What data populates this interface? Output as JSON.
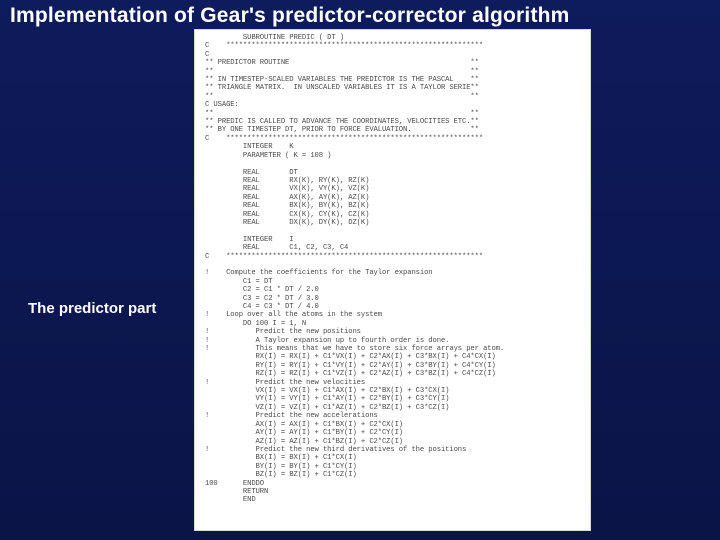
{
  "title": "Implementation of Gear's predictor-corrector algorithm",
  "caption": "The predictor part",
  "code": "         SUBROUTINE PREDIC ( DT )\nC    *************************************************************\nC\n** PREDICTOR ROUTINE                                           **\n**                                                             **\n** IN TIMESTEP-SCALED VARIABLES THE PREDICTOR IS THE PASCAL    **\n** TRIANGLE MATRIX.  IN UNSCALED VARIABLES IT IS A TAYLOR SERIE**\n**                                                             **\nC USAGE:                                                          \n**                                                             **\n** PREDIC IS CALLED TO ADVANCE THE COORDINATES, VELOCITIES ETC.**\n** BY ONE TIMESTEP DT, PRIOR TO FORCE EVALUATION.              **\nC    *************************************************************\n         INTEGER    K\n         PARAMETER ( K = 108 )\n\n         REAL       DT\n         REAL       RX(K), RY(K), RZ(K)\n         REAL       VX(K), VY(K), VZ(K)\n         REAL       AX(K), AY(K), AZ(K)\n         REAL       BX(K), BY(K), BZ(K)\n         REAL       CX(K), CY(K), CZ(K)\n         REAL       DX(K), DY(K), DZ(K)\n\n         INTEGER    I\n         REAL       C1, C2, C3, C4\nC    *************************************************************\n\n!    Compute the coefficients for the Taylor expansion\n         C1 = DT\n         C2 = C1 * DT / 2.0\n         C3 = C2 * DT / 3.0\n         C4 = C3 * DT / 4.0\n!    Loop over all the atoms in the system\n         DO 100 I = 1, N\n!           Predict the new positions\n!           A Taylor expansion up to fourth order is done.\n!           This means that we have to store six force arrays per atom.\n            RX(I) = RX(I) + C1*VX(I) + C2*AX(I) + C3*BX(I) + C4*CX(I)\n            RY(I) = RY(I) + C1*VY(I) + C2*AY(I) + C3*BY(I) + C4*CY(I)\n            RZ(I) = RZ(I) + C1*VZ(I) + C2*AZ(I) + C3*BZ(I) + C4*CZ(I)\n!           Predict the new velocities\n            VX(I) = VX(I) + C1*AX(I) + C2*BX(I) + C3*CX(I)\n            VY(I) = VY(I) + C1*AY(I) + C2*BY(I) + C3*CY(I)\n            VZ(I) = VZ(I) + C1*AZ(I) + C2*BZ(I) + C3*CZ(I)\n!           Predict the new accelerations\n            AX(I) = AX(I) + C1*BX(I) + C2*CX(I)\n            AY(I) = AY(I) + C1*BY(I) + C2*CY(I)\n            AZ(I) = AZ(I) + C1*BZ(I) + C2*CZ(I)\n!           Predict the new third derivatives of the positions\n            BX(I) = BX(I) + C1*CX(I)\n            BY(I) = BY(I) + C1*CY(I)\n            BZ(I) = BZ(I) + C1*CZ(I)\n100      ENDDO\n         RETURN\n         END"
}
